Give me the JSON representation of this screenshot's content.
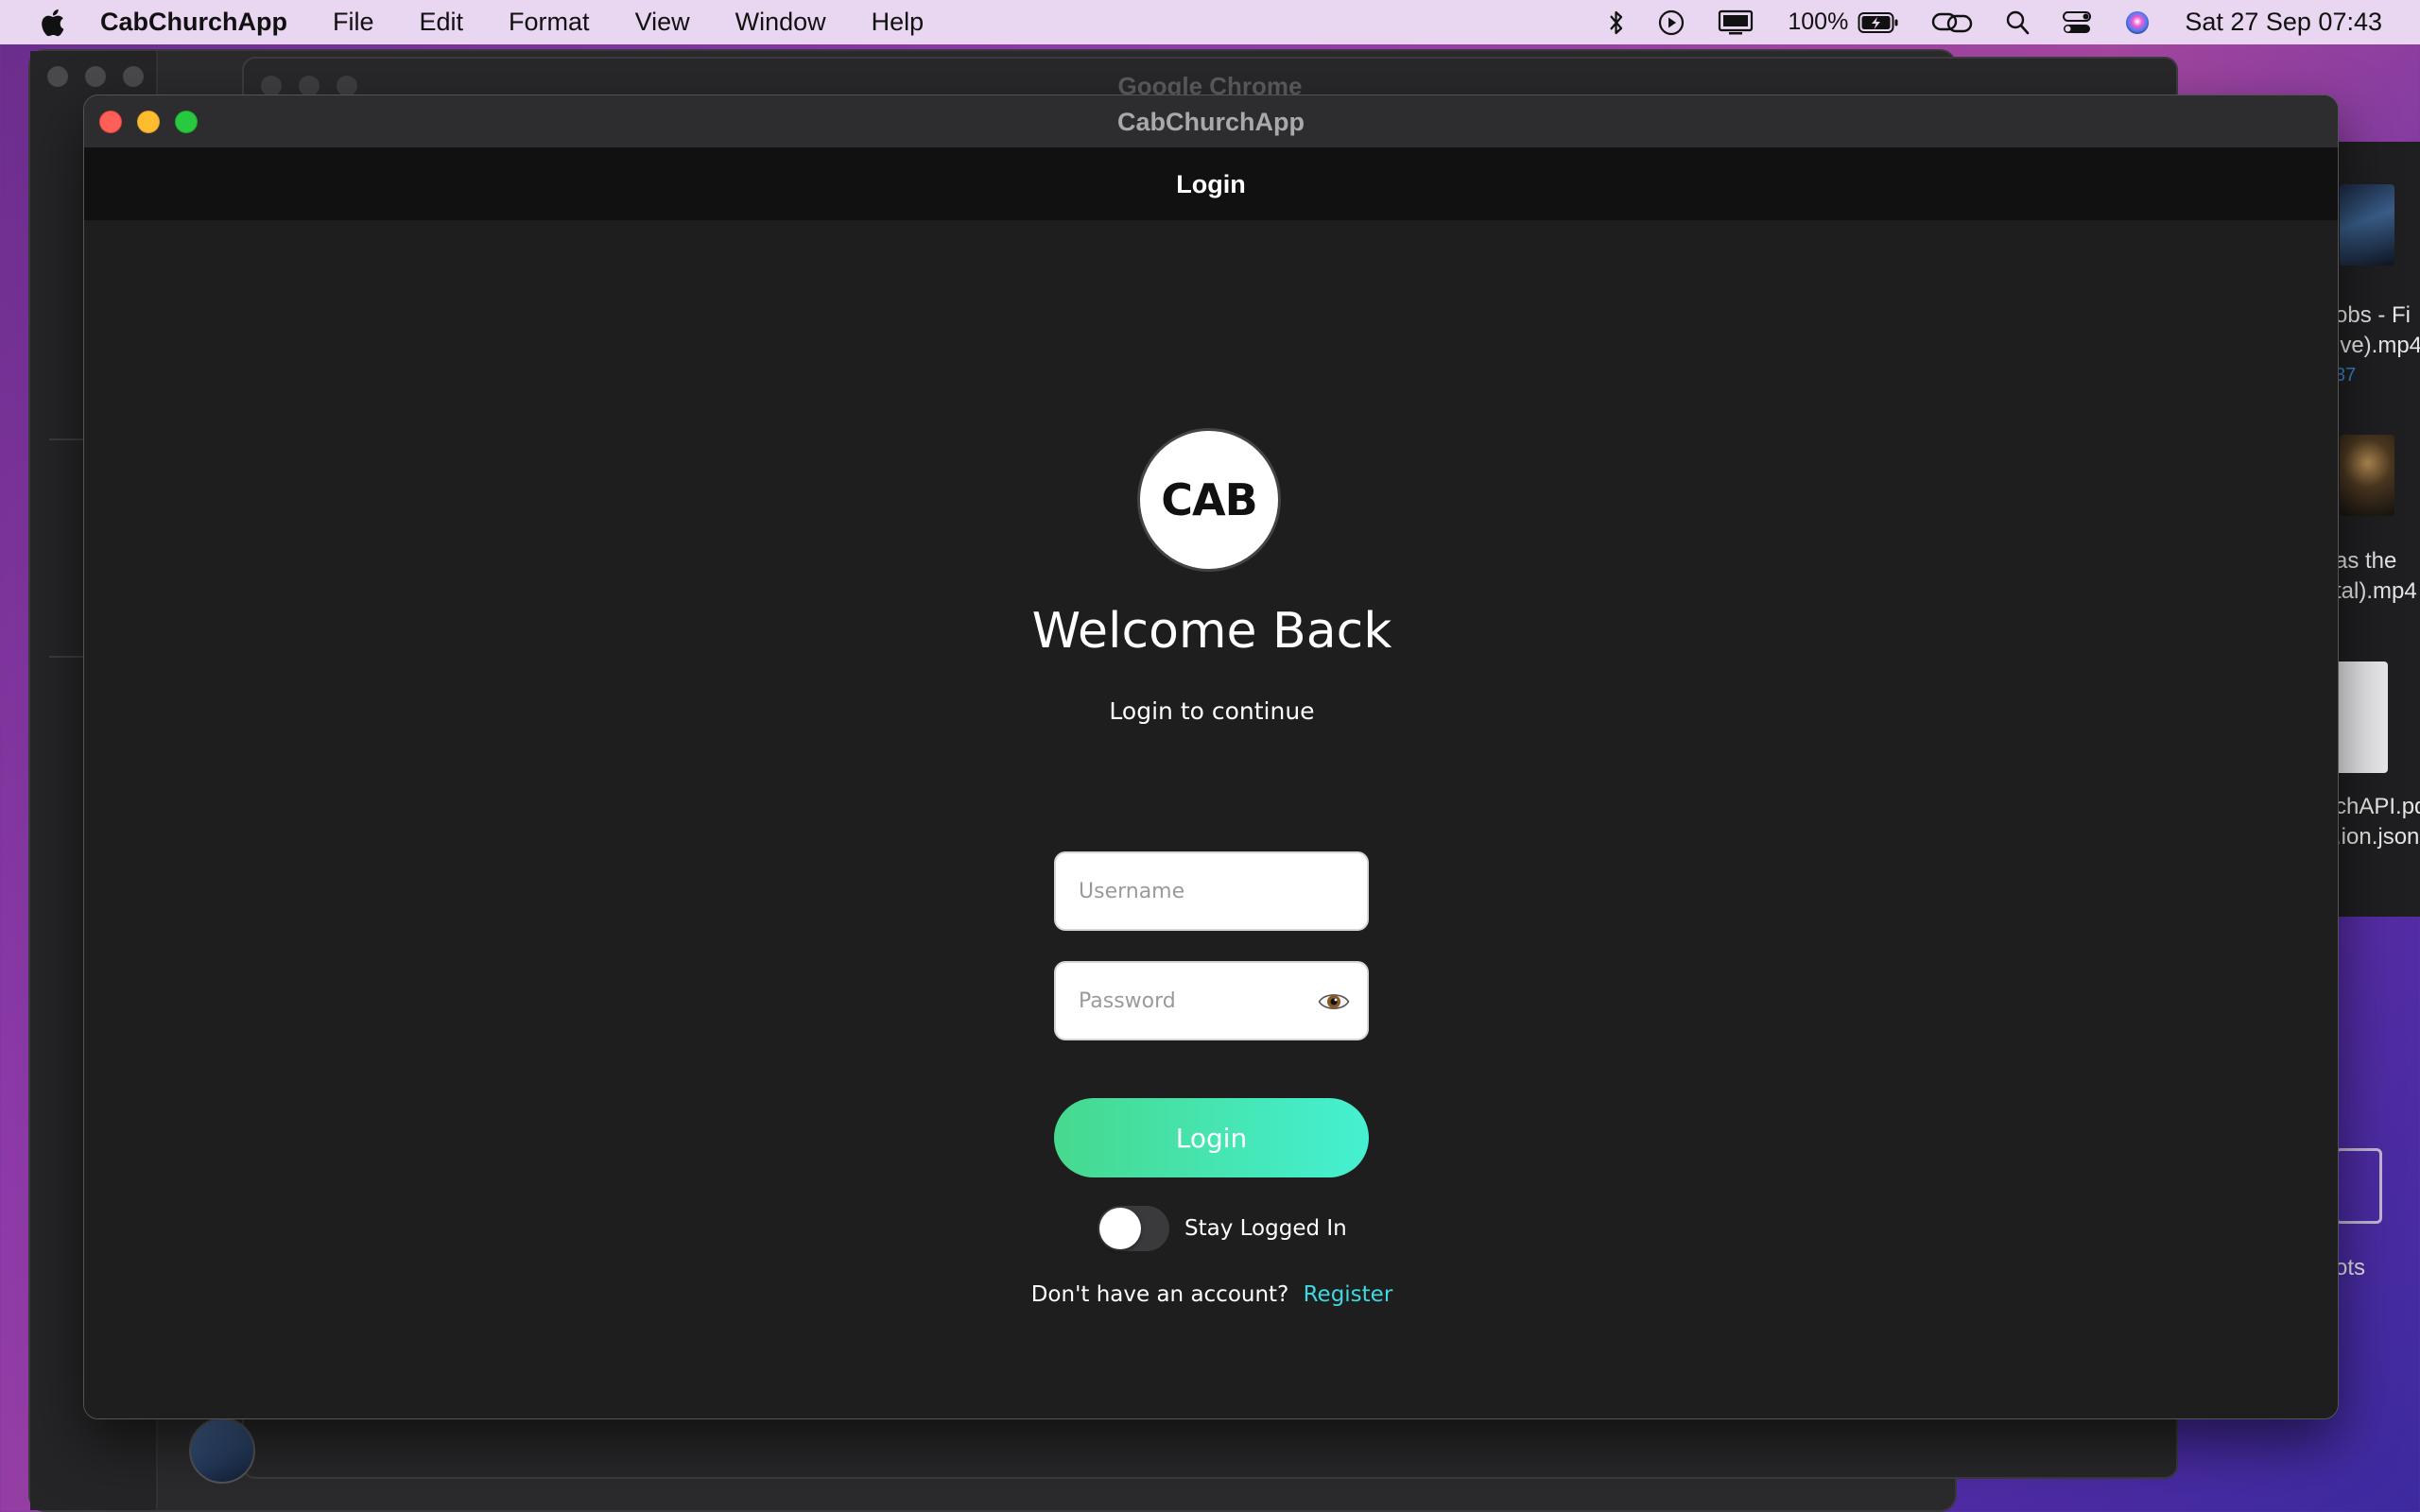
{
  "menubar": {
    "app_name": "CabChurchApp",
    "items": [
      "File",
      "Edit",
      "Format",
      "View",
      "Window",
      "Help"
    ],
    "battery": "100%",
    "clock": "Sat 27 Sep  07:43"
  },
  "background": {
    "chrome_title": "Google Chrome",
    "finder_texts": [
      "obs - Fi",
      "ive).mp4",
      "37",
      "as the",
      "tal).mp4",
      "chAPI.pd",
      ".ion.json",
      "ots"
    ]
  },
  "window": {
    "title": "CabChurchApp",
    "nav_title": "Login"
  },
  "login": {
    "logo_text": "CAB",
    "heading": "Welcome Back",
    "subheading": "Login to continue",
    "username_placeholder": "Username",
    "password_placeholder": "Password",
    "login_button": "Login",
    "stay_logged_in": "Stay Logged In",
    "no_account_text": "Don't have an account?",
    "register_link": "Register"
  },
  "colors": {
    "accent_start": "#46d98e",
    "accent_end": "#45f0d2",
    "link": "#3fd8e0",
    "background": "#1e1e1e"
  }
}
